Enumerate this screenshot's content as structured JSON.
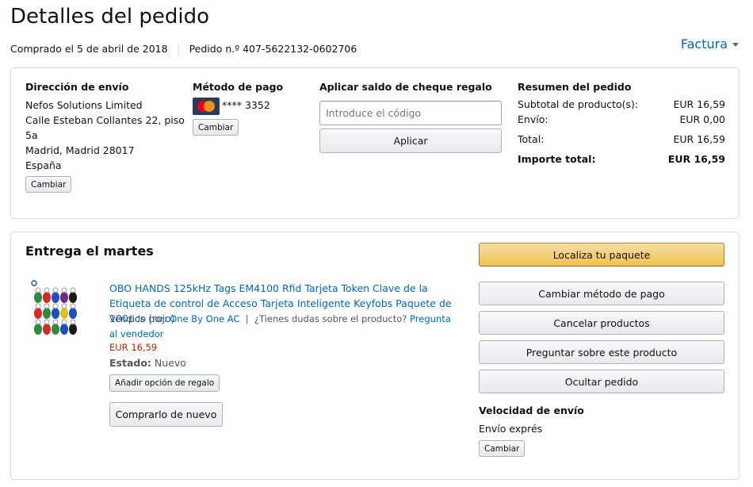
{
  "header": {
    "title": "Detalles del pedido",
    "purchased": "Comprado el 5 de abril de 2018",
    "order_number": "Pedido n.º 407-5622132-0602706",
    "invoice_label": "Factura"
  },
  "shipping_address": {
    "heading": "Dirección de envío",
    "lines": [
      "Nefos Solutions Limited",
      "Calle Esteban Collantes 22, piso",
      "5a",
      "Madrid, Madrid 28017",
      "España"
    ],
    "change_label": "Cambiar"
  },
  "payment": {
    "heading": "Método de pago",
    "card_icon": "mastercard-icon",
    "card_text": "**** 3352",
    "change_label": "Cambiar"
  },
  "gift_card": {
    "heading": "Aplicar saldo de cheque regalo",
    "placeholder": "Introduce el código",
    "value": "",
    "apply_label": "Aplicar"
  },
  "summary": {
    "heading": "Resumen del pedido",
    "rows": [
      {
        "label": "Subtotal de producto(s):",
        "value": "EUR 16,59"
      },
      {
        "label": "Envío:",
        "value": "EUR 0,00"
      },
      {
        "label": "Total:",
        "value": "EUR 16,59"
      },
      {
        "label": "Importe total:",
        "value": "EUR 16,59"
      }
    ]
  },
  "delivery": {
    "heading": "Entrega el martes",
    "product": {
      "title": "OBO HANDS 125kHz Tags EM4100 Rfid Tarjeta Token Clave de la Etiqueta de control de Acceso Tarjeta Inteligente Keyfobs Paquete de 100pcs (rojo)",
      "sold_by_label": "Vendido por:",
      "seller": "One By One AC",
      "question_text": "¿Tienes dudas sobre el producto?",
      "ask_seller": "Pregunta al vendedor",
      "price": "EUR 16,59",
      "condition_label": "Estado:",
      "condition_value": "Nuevo",
      "gift_option_label": "Añadir opción de regalo",
      "buy_again_label": "Comprarlo de nuevo"
    },
    "actions": {
      "track": "Localiza tu paquete",
      "change_payment": "Cambiar método de pago",
      "cancel": "Cancelar productos",
      "ask_product": "Preguntar sobre este producto",
      "hide_order": "Ocultar pedido"
    },
    "shipping_speed": {
      "heading": "Velocidad de envío",
      "value": "Envío exprés",
      "change_label": "Cambiar"
    }
  },
  "colors": {
    "link": "#0066c0",
    "price": "#b12704",
    "primary_button": "#f0c14b",
    "border": "#dddddd"
  }
}
